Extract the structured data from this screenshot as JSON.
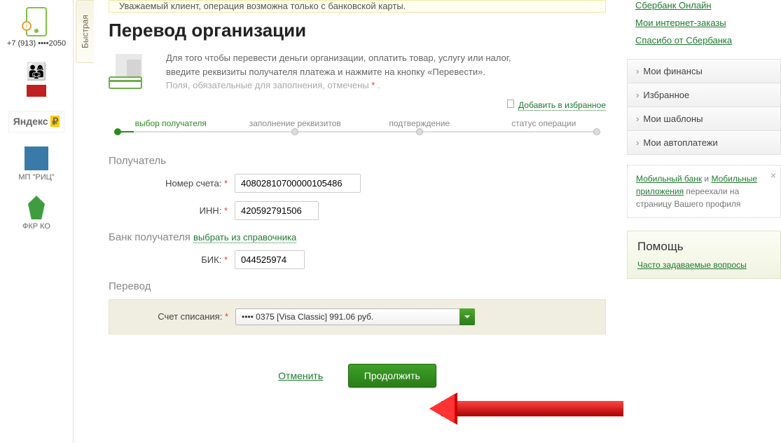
{
  "leftrail": {
    "fastpay_tab": "Быстрая",
    "phone": "+7 (913) ••••2050",
    "items": [
      "МП \"РИЦ\"",
      "ФКР КО"
    ],
    "yandex": "Яндекс"
  },
  "banner": "Уважаемый клиент, операция возможна только с банковской карты.",
  "title": "Перевод организации",
  "intro": {
    "line1": "Для того чтобы перевести деньги организации, оплатить товар, услугу или налог, введите реквизиты получателя платежа и нажмите на кнопку «Перевести».",
    "line2": "Поля, обязательные для заполнения, отмечены ",
    "dot": "."
  },
  "fav_link": "Добавить в избранное",
  "steps": [
    "выбор получателя",
    "заполнение реквизитов",
    "подтверждение",
    "статус операции"
  ],
  "section_recipient": "Получатель",
  "fields": {
    "account_label": "Номер счета:",
    "account_value": "40802810700000105486",
    "inn_label": "ИНН:",
    "inn_value": "420592791506",
    "bank_section": "Банк получателя",
    "bank_dir": "выбрать из справочника",
    "bik_label": "БИК:",
    "bik_value": "044525974"
  },
  "section_transfer": "Перевод",
  "transfer": {
    "account_from_label": "Счет списания:",
    "account_from_value": "•••• 0375 [Visa Classic] 991.06 руб."
  },
  "actions": {
    "cancel": "Отменить",
    "continue": "Продолжить"
  },
  "right": {
    "links": [
      "Сбербанк Онлайн",
      "Мои интернет-заказы",
      "Спасибо от Сбербанка"
    ],
    "accordion": [
      "Мои финансы",
      "Избранное",
      "Мои шаблоны",
      "Мои автоплатежи"
    ],
    "info_mb": "Мобильный банк",
    "info_and": " и ",
    "info_ma": "Мобильные приложения",
    "info_rest": " переехали на страницу Вашего профиля",
    "help_title": "Помощь",
    "help_link": "Часто задаваемые вопросы"
  }
}
